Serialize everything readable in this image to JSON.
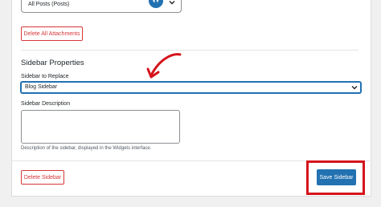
{
  "post_type_select": {
    "value": "All Posts (Posts)",
    "icon": "eye-hide-icon"
  },
  "buttons": {
    "delete_attachments": "Delete All Attachments",
    "delete_sidebar": "Delete Sidebar",
    "save_sidebar": "Save Sidebar"
  },
  "sidebar_properties": {
    "title": "Sidebar Properties",
    "replace_label": "Sidebar to Replace",
    "replace_value": "Blog Sidebar",
    "description_label": "Sidebar Description",
    "description_value": "",
    "description_help": "Description of the sidebar, displayed in the Widgets interface."
  },
  "annotations": {
    "arrow_color": "#d5141c",
    "highlight_color": "#d5141c"
  },
  "colors": {
    "primary": "#2271b1",
    "danger": "#d63638"
  }
}
